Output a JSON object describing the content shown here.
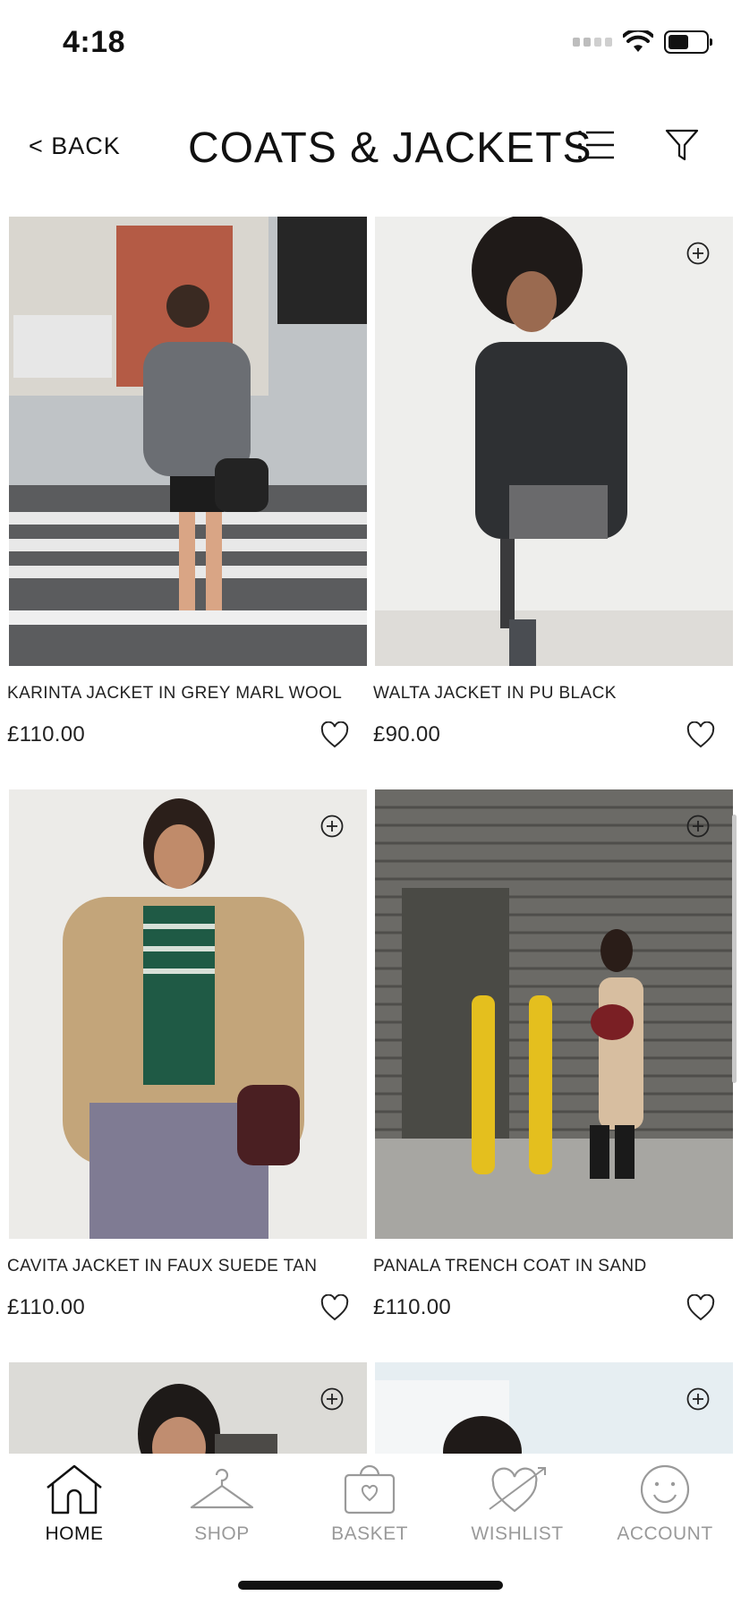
{
  "status_bar": {
    "time": "4:18"
  },
  "header": {
    "back_label": "< BACK",
    "title": "COATS & JACKETS"
  },
  "products": [
    {
      "name": "KARINTA JACKET IN GREY MARL WOOL",
      "price": "£110.00"
    },
    {
      "name": "WALTA JACKET IN PU BLACK",
      "price": "£90.00"
    },
    {
      "name": "CAVITA JACKET IN FAUX SUEDE TAN",
      "price": "£110.00"
    },
    {
      "name": "PANALA TRENCH COAT IN SAND",
      "price": "£110.00"
    }
  ],
  "nav": {
    "items": [
      {
        "label": "HOME",
        "icon": "home-icon",
        "active": true
      },
      {
        "label": "SHOP",
        "icon": "hanger-icon",
        "active": false
      },
      {
        "label": "BASKET",
        "icon": "basket-icon",
        "active": false
      },
      {
        "label": "WISHLIST",
        "icon": "heart-arrow-icon",
        "active": false
      },
      {
        "label": "ACCOUNT",
        "icon": "smiley-icon",
        "active": false
      }
    ]
  },
  "colors": {
    "text": "#111111",
    "inactive": "#9a9a9a",
    "background": "#ffffff"
  }
}
